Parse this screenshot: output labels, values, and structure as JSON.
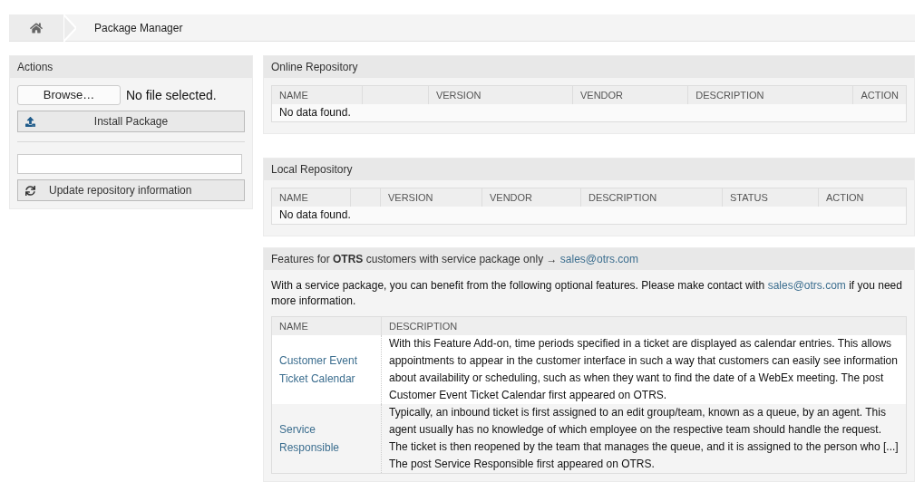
{
  "breadcrumb": {
    "title": "Package Manager"
  },
  "actions": {
    "title": "Actions",
    "browse_button": "Browse…",
    "file_status": "No file selected.",
    "install_button": "Install Package",
    "update_button": "Update repository information"
  },
  "online_repository": {
    "title": "Online Repository",
    "columns": [
      "NAME",
      "",
      "VERSION",
      "VENDOR",
      "DESCRIPTION",
      "ACTION"
    ],
    "empty": "No data found."
  },
  "local_repository": {
    "title": "Local Repository",
    "columns": [
      "NAME",
      "",
      "VERSION",
      "VENDOR",
      "DESCRIPTION",
      "STATUS",
      "ACTION"
    ],
    "empty": "No data found."
  },
  "features": {
    "title": "Features for **OTRS** customers with service package only →",
    "title_link": "sales@otrs.com",
    "intro_before": "With a service package, you can benefit from the following optional features. Please make contact with",
    "intro_link": "sales@otrs.com",
    "intro_after": "if you need more information.",
    "columns": [
      "NAME",
      "DESCRIPTION"
    ],
    "rows": [
      {
        "name": "Customer Event Ticket Calendar",
        "description": "With this Feature Add-on, time periods specified in a ticket are displayed as calendar entries. This allows appointments to appear in the customer interface in such a way that customers can easily see information about availability or scheduling, such as when they want to find the date of a WebEx meeting. The post Customer Event Ticket Calendar first appeared on OTRS."
      },
      {
        "name": "Service Responsible",
        "description": "Typically, an inbound ticket is first assigned to an edit group/team, known as a queue, by an agent. This agent usually has no knowledge of which employee on the respective team should handle the request. The ticket is then reopened by the team that manages the queue, and it is assigned to the person who [...] The post Service Responsible first appeared on OTRS."
      }
    ]
  }
}
